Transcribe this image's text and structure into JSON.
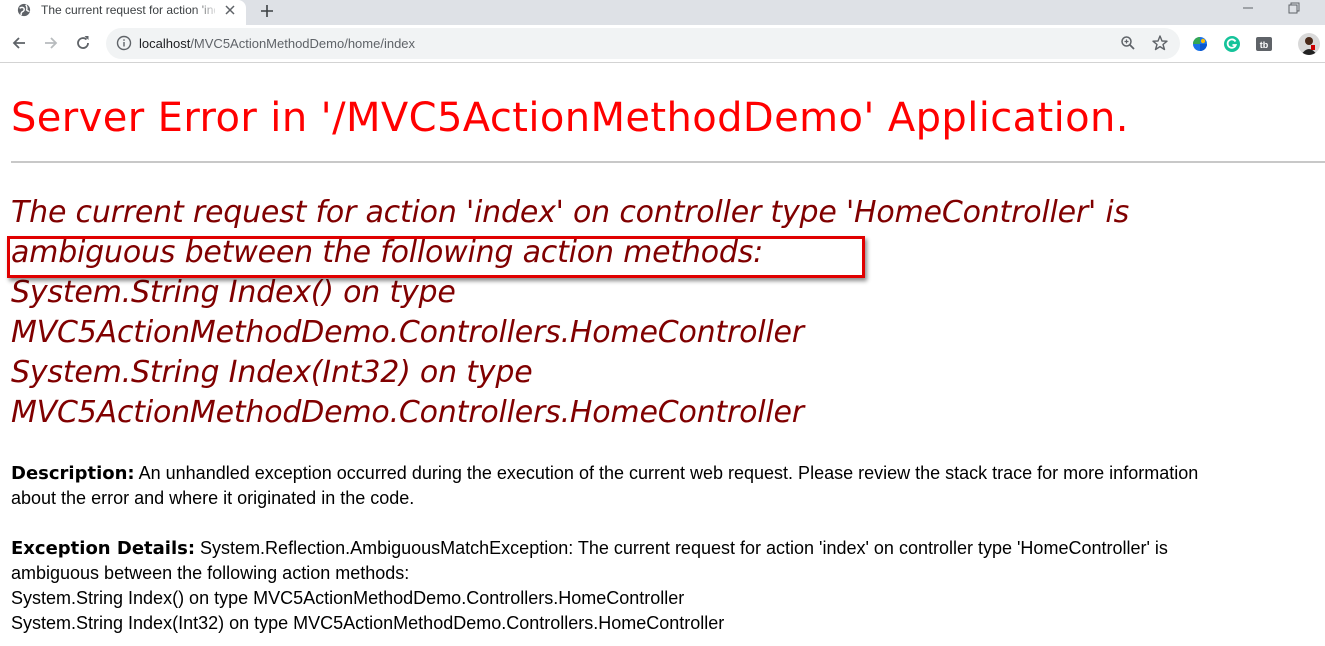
{
  "browser": {
    "tab_title": "The current request for action 'index' on controller type 'HomeController' is ambiguous",
    "url_host": "localhost",
    "url_path": "/MVC5ActionMethodDemo/home/index",
    "icons": {
      "favicon": "globe-icon",
      "close": "close-icon",
      "new_tab": "plus-icon",
      "back": "back-arrow-icon",
      "forward": "forward-arrow-icon",
      "reload": "reload-icon",
      "site_info": "info-icon",
      "zoom": "zoom-icon",
      "bookmark": "star-icon",
      "extensions": [
        "colorful-ball-extension-icon",
        "grammarly-icon",
        "tb-extension-icon"
      ],
      "profile": "avatar"
    }
  },
  "page": {
    "title": "Server Error in '/MVC5ActionMethodDemo' Application.",
    "error_lines": [
      "The current request for action 'index' on controller type 'HomeController' is",
      "ambiguous between the following action methods:",
      "System.String Index() on type",
      "MVC5ActionMethodDemo.Controllers.HomeController",
      "System.String Index(Int32) on type",
      "MVC5ActionMethodDemo.Controllers.HomeController"
    ],
    "description_label": "Description:",
    "description_line1": " An unhandled exception occurred during the execution of the current web request. Please review the stack trace for more information",
    "description_line2": "about the error and where it originated in the code.",
    "exception_label": "Exception Details:",
    "exception_line1": " System.Reflection.AmbiguousMatchException: The current request for action 'index' on controller type 'HomeController' is",
    "exception_line2": "ambiguous between the following action methods:",
    "exception_line3": "System.String Index() on type MVC5ActionMethodDemo.Controllers.HomeController",
    "exception_line4": "System.String Index(Int32) on type MVC5ActionMethodDemo.Controllers.HomeController"
  },
  "colors": {
    "title": "#ff0000",
    "error_message": "#800000",
    "highlight_border": "#e00000",
    "chrome_background": "#dee1e6",
    "omnibox_background": "#f1f3f4"
  }
}
